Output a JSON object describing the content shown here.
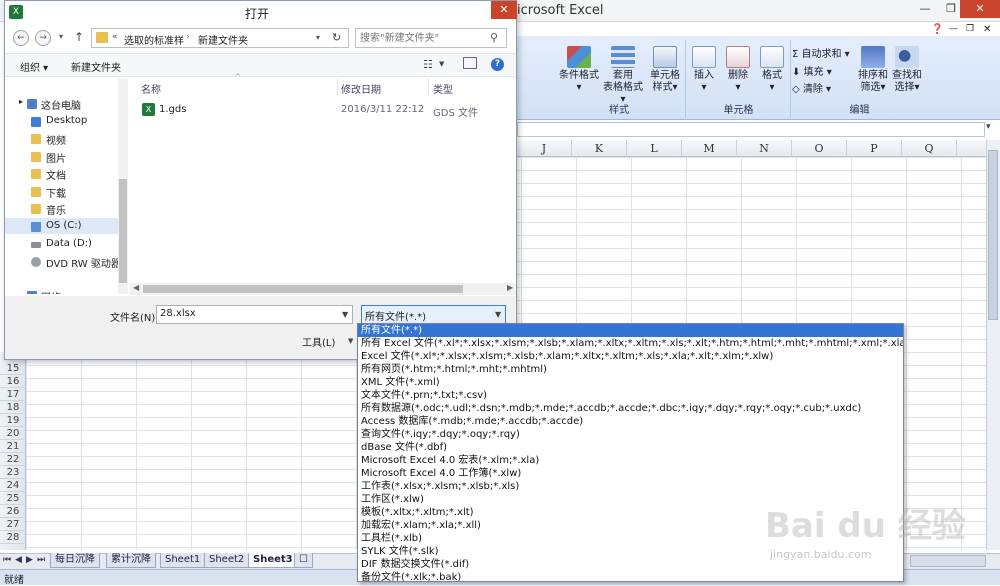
{
  "excel": {
    "title": "icrosoft Excel",
    "ribbon": {
      "styles_group": "样式",
      "cells_group": "单元格",
      "editing_group": "编辑",
      "cond_fmt": [
        "条件格式",
        "▾"
      ],
      "table_fmt": [
        "套用",
        "表格格式▾"
      ],
      "cell_style": [
        "单元格",
        "样式▾"
      ],
      "insert": [
        "插入",
        "▾"
      ],
      "delete": [
        "删除",
        "▾"
      ],
      "format": [
        "格式",
        "▾"
      ],
      "autosum": "Σ 自动求和 ▾",
      "fill": "⬇ 填充 ▾",
      "clear": "◇ 清除 ▾",
      "sort": [
        "排序和",
        "筛选▾"
      ],
      "find": [
        "查找和",
        "选择▾"
      ]
    },
    "columns": [
      "J",
      "K",
      "L",
      "M",
      "N",
      "O",
      "P",
      "Q"
    ],
    "rows": [
      "15",
      "16",
      "17",
      "18",
      "19",
      "20",
      "21",
      "22",
      "23",
      "24",
      "25",
      "26",
      "27",
      "28"
    ],
    "sheets": [
      "每日沉降",
      "累计沉降",
      "Sheet1",
      "Sheet2",
      "Sheet3"
    ],
    "active_sheet": "Sheet3",
    "status": "就绪"
  },
  "dialog": {
    "title": "打开",
    "address": {
      "prefix": "«",
      "crumb1": "选取的标准样",
      "crumb2": "新建文件夹"
    },
    "search_placeholder": "搜索\"新建文件夹\"",
    "toolbar": {
      "organize": "组织 ▾",
      "new_folder": "新建文件夹"
    },
    "nav": [
      {
        "label": "这台电脑",
        "color": "#4d7fc4"
      },
      {
        "label": "Desktop",
        "color": "#3f7fd6"
      },
      {
        "label": "视频",
        "color": "#e8c04f"
      },
      {
        "label": "图片",
        "color": "#e8c04f"
      },
      {
        "label": "文档",
        "color": "#e8c04f"
      },
      {
        "label": "下载",
        "color": "#e8c04f"
      },
      {
        "label": "音乐",
        "color": "#e8c04f"
      },
      {
        "label": "OS (C:)",
        "color": "#5a8fd0"
      },
      {
        "label": "Data (D:)",
        "color": "#8a8f98"
      },
      {
        "label": "DVD RW 驱动器",
        "color": "#9aa0a8"
      },
      {
        "label": "网络",
        "color": "#4d7fc4"
      }
    ],
    "columns": {
      "name": "名称",
      "date": "修改日期",
      "type": "类型"
    },
    "files": [
      {
        "name": "1.gds",
        "date": "2016/3/11 22:12",
        "type": "GDS 文件"
      }
    ],
    "filename_label": "文件名(N):",
    "filename_value": "28.xlsx",
    "filetype_value": "所有文件(*.*)",
    "tools_label": "工具(L)"
  },
  "filetype_options": [
    "所有文件(*.*)",
    "所有 Excel 文件(*.xl*;*.xlsx;*.xlsm;*.xlsb;*.xlam;*.xltx;*.xltm;*.xls;*.xlt;*.htm;*.html;*.mht;*.mhtml;*.xml;*.xla;*.xlm;*.xlw;*.odc;*.uxdc)",
    "Excel 文件(*.xl*;*.xlsx;*.xlsm;*.xlsb;*.xlam;*.xltx;*.xltm;*.xls;*.xla;*.xlt;*.xlm;*.xlw)",
    "所有网页(*.htm;*.html;*.mht;*.mhtml)",
    "XML 文件(*.xml)",
    "文本文件(*.prn;*.txt;*.csv)",
    "所有数据源(*.odc;*.udl;*.dsn;*.mdb;*.mde;*.accdb;*.accde;*.dbc;*.iqy;*.dqy;*.rqy;*.oqy;*.cub;*.uxdc)",
    "Access 数据库(*.mdb;*.mde;*.accdb;*.accde)",
    "查询文件(*.iqy;*.dqy;*.oqy;*.rqy)",
    "dBase 文件(*.dbf)",
    "Microsoft Excel 4.0 宏表(*.xlm;*.xla)",
    "Microsoft Excel 4.0 工作簿(*.xlw)",
    "工作表(*.xlsx;*.xlsm;*.xlsb;*.xls)",
    "工作区(*.xlw)",
    "模板(*.xltx;*.xltm;*.xlt)",
    "加载宏(*.xlam;*.xla;*.xll)",
    "工具栏(*.xlb)",
    "SYLK 文件(*.slk)",
    "DIF 数据交换文件(*.dif)",
    "备份文件(*.xlk;*.bak)"
  ],
  "watermark": {
    "main": "Bai du 经验",
    "sub": "jingyan.baidu.com"
  }
}
